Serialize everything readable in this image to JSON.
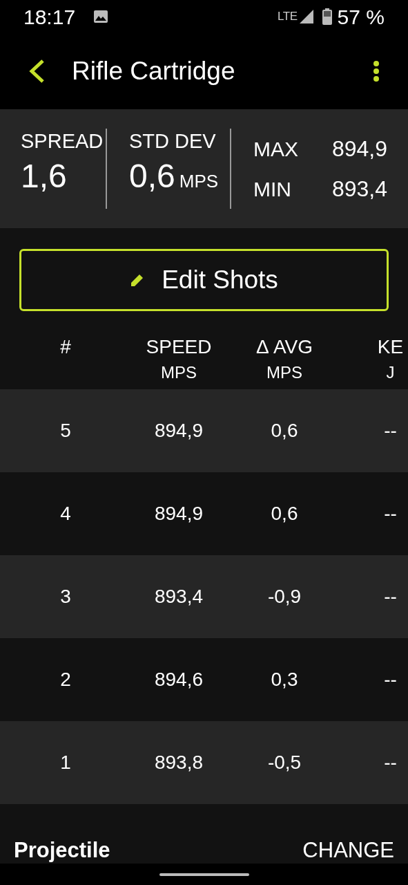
{
  "status_bar": {
    "time": "18:17",
    "network": "LTE",
    "battery": "57 %"
  },
  "app_bar": {
    "title": "Rifle Cartridge"
  },
  "stats": {
    "spread": {
      "label": "SPREAD",
      "value": "1,6"
    },
    "std_dev": {
      "label": "STD DEV",
      "value": "0,6",
      "unit": "MPS"
    },
    "max": {
      "label": "MAX",
      "value": "894,9"
    },
    "min": {
      "label": "MIN",
      "value": "893,4"
    }
  },
  "edit_button": {
    "label": "Edit Shots"
  },
  "table": {
    "columns": [
      {
        "title": "#"
      },
      {
        "title": "SPEED",
        "unit": "MPS"
      },
      {
        "title": "Δ AVG",
        "unit": "MPS"
      },
      {
        "title": "KE",
        "unit": "J"
      }
    ],
    "rows": [
      {
        "cells": [
          "5",
          "894,9",
          "0,6",
          "--"
        ]
      },
      {
        "cells": [
          "4",
          "894,9",
          "0,6",
          "--"
        ]
      },
      {
        "cells": [
          "3",
          "893,4",
          "-0,9",
          "--"
        ]
      },
      {
        "cells": [
          "2",
          "894,6",
          "0,3",
          "--"
        ]
      },
      {
        "cells": [
          "1",
          "893,8",
          "-0,5",
          "--"
        ]
      }
    ]
  },
  "projectile": {
    "title": "Projectile",
    "action": "CHANGE"
  }
}
